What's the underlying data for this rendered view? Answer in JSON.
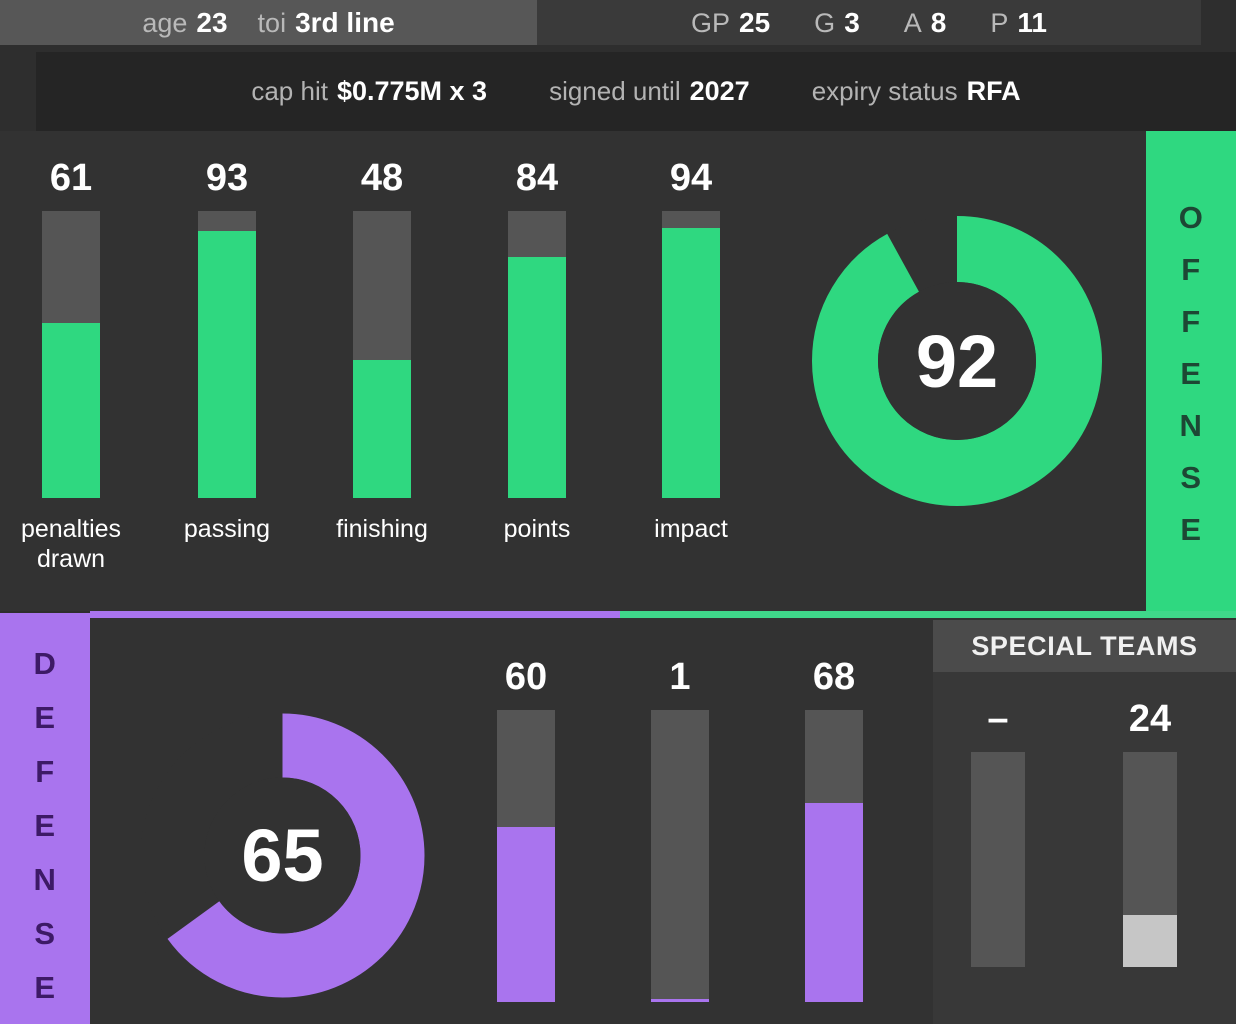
{
  "header": {
    "left_stats": [
      {
        "key": "age",
        "value": "23"
      },
      {
        "key": "toi",
        "value": "3rd line"
      }
    ],
    "right_stats": [
      {
        "key": "GP",
        "value": "25"
      },
      {
        "key": "G",
        "value": "3"
      },
      {
        "key": "A",
        "value": "8"
      },
      {
        "key": "P",
        "value": "11"
      }
    ],
    "contract": [
      {
        "key": "cap hit",
        "value": "$0.775M x 3"
      },
      {
        "key": "signed until",
        "value": "2027"
      },
      {
        "key": "expiry status",
        "value": "RFA"
      }
    ]
  },
  "offense": {
    "panel_label": "OFFENSE",
    "panel_letters": [
      "O",
      "F",
      "F",
      "E",
      "N",
      "S",
      "E"
    ],
    "accent_color": "#2fd880",
    "track_color": "#555555",
    "rating": {
      "label": "offense-rating",
      "value": "92",
      "percent": 92
    }
  },
  "defense": {
    "panel_label": "DEFENSE",
    "panel_letters": [
      "D",
      "E",
      "F",
      "E",
      "N",
      "S",
      "E"
    ],
    "accent_color": "#a974ee",
    "track_color": "#555555",
    "rating": {
      "label": "defense-rating",
      "value": "65",
      "percent": 65
    }
  },
  "special_teams": {
    "title": "SPECIAL TEAMS",
    "accent_color": "#c6c6c6",
    "track_color": "#555555"
  },
  "chart_data": [
    {
      "type": "bar",
      "title": "OFFENSE",
      "orientation": "vertical",
      "categories": [
        "penalties\ndrawn",
        "passing",
        "finishing",
        "points",
        "impact"
      ],
      "values": [
        61,
        93,
        48,
        84,
        94
      ],
      "ylim": [
        0,
        100
      ],
      "bar_color": "#2fd880",
      "track_color": "#555555",
      "grid": false,
      "legend": null,
      "gauge": {
        "type": "donut",
        "label": "offense",
        "value": 92,
        "max": 100,
        "color": "#2fd880"
      }
    },
    {
      "type": "bar",
      "title": "DEFENSE",
      "orientation": "vertical",
      "categories": [
        "",
        "",
        ""
      ],
      "values": [
        60,
        1,
        68
      ],
      "ylim": [
        0,
        100
      ],
      "bar_color": "#a974ee",
      "track_color": "#555555",
      "grid": false,
      "legend": null,
      "gauge": {
        "type": "donut",
        "label": "defense",
        "value": 65,
        "max": 100,
        "color": "#a974ee"
      }
    },
    {
      "type": "bar",
      "title": "SPECIAL TEAMS",
      "orientation": "vertical",
      "categories": [
        "",
        ""
      ],
      "values": [
        null,
        24
      ],
      "value_labels": [
        "–",
        "24"
      ],
      "ylim": [
        0,
        100
      ],
      "bar_color": "#c6c6c6",
      "track_color": "#555555",
      "grid": false,
      "legend": null
    }
  ],
  "offense_bars": [
    {
      "label": "penalties\ndrawn",
      "value": "61",
      "percent": 61
    },
    {
      "label": "passing",
      "value": "93",
      "percent": 93
    },
    {
      "label": "finishing",
      "value": "48",
      "percent": 48
    },
    {
      "label": "points",
      "value": "84",
      "percent": 84
    },
    {
      "label": "impact",
      "value": "94",
      "percent": 94
    }
  ],
  "defense_bars": [
    {
      "label": "",
      "value": "60",
      "percent": 60
    },
    {
      "label": "",
      "value": "1",
      "percent": 1
    },
    {
      "label": "",
      "value": "68",
      "percent": 68
    }
  ],
  "special_teams_bars": [
    {
      "label": "",
      "value": "–",
      "percent": 0
    },
    {
      "label": "",
      "value": "24",
      "percent": 24
    }
  ]
}
